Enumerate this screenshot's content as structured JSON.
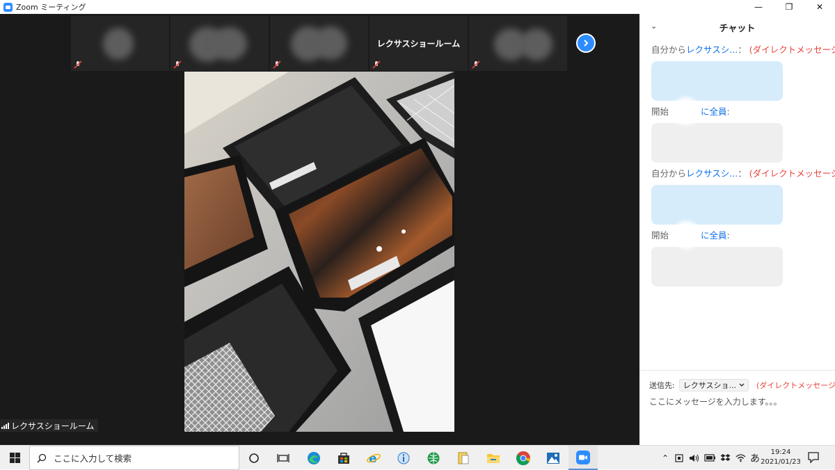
{
  "window": {
    "title": "Zoom ミーティング",
    "controls": {
      "minimize": "—",
      "restore": "❐",
      "close": "✕"
    }
  },
  "meeting": {
    "thumbnails": [
      {
        "type": "video",
        "name": ""
      },
      {
        "type": "video",
        "name": ""
      },
      {
        "type": "video",
        "name": ""
      },
      {
        "type": "name",
        "name": "レクサスショールーム"
      },
      {
        "type": "video",
        "name": ""
      }
    ],
    "active_speaker": "レクサスショールーム"
  },
  "chat": {
    "title": "チャット",
    "messages": [
      {
        "prefix": "自分から",
        "to": "レクサスシ...",
        "sep": "：",
        "dm": "(ダイレクトメッセージ)"
      },
      {
        "prefix": "開始",
        "to": "に全員",
        "sep": ":",
        "dm": ""
      },
      {
        "prefix": "自分から",
        "to": "レクサスシ...",
        "sep": "：",
        "dm": "(ダイレクトメッセージ)"
      },
      {
        "prefix": "開始",
        "to": "に全員",
        "sep": ":",
        "dm": ""
      }
    ],
    "send_to_label": "送信先:",
    "send_to_value": "レクサスショ...",
    "send_to_dm": "(ダイレクトメッセージ)",
    "input_placeholder": "ここにメッセージを入力します。。。"
  },
  "taskbar": {
    "search_placeholder": "ここに入力して検索",
    "pinned": [
      {
        "name": "cortana-icon"
      },
      {
        "name": "task-view-icon"
      },
      {
        "name": "edge-icon"
      },
      {
        "name": "store-icon"
      },
      {
        "name": "ie-icon"
      },
      {
        "name": "info-icon"
      },
      {
        "name": "globe-app-icon"
      },
      {
        "name": "notes-app-icon"
      },
      {
        "name": "file-explorer-icon"
      },
      {
        "name": "chrome-icon"
      },
      {
        "name": "photos-icon"
      },
      {
        "name": "zoom-icon"
      }
    ],
    "ime": "あ",
    "time": "19:24",
    "date": "2021/01/23"
  },
  "colors": {
    "accent": "#2d8cff",
    "link": "#0e72ed",
    "dm": "#e8423c",
    "meeting_bg": "#1a1a1a"
  }
}
